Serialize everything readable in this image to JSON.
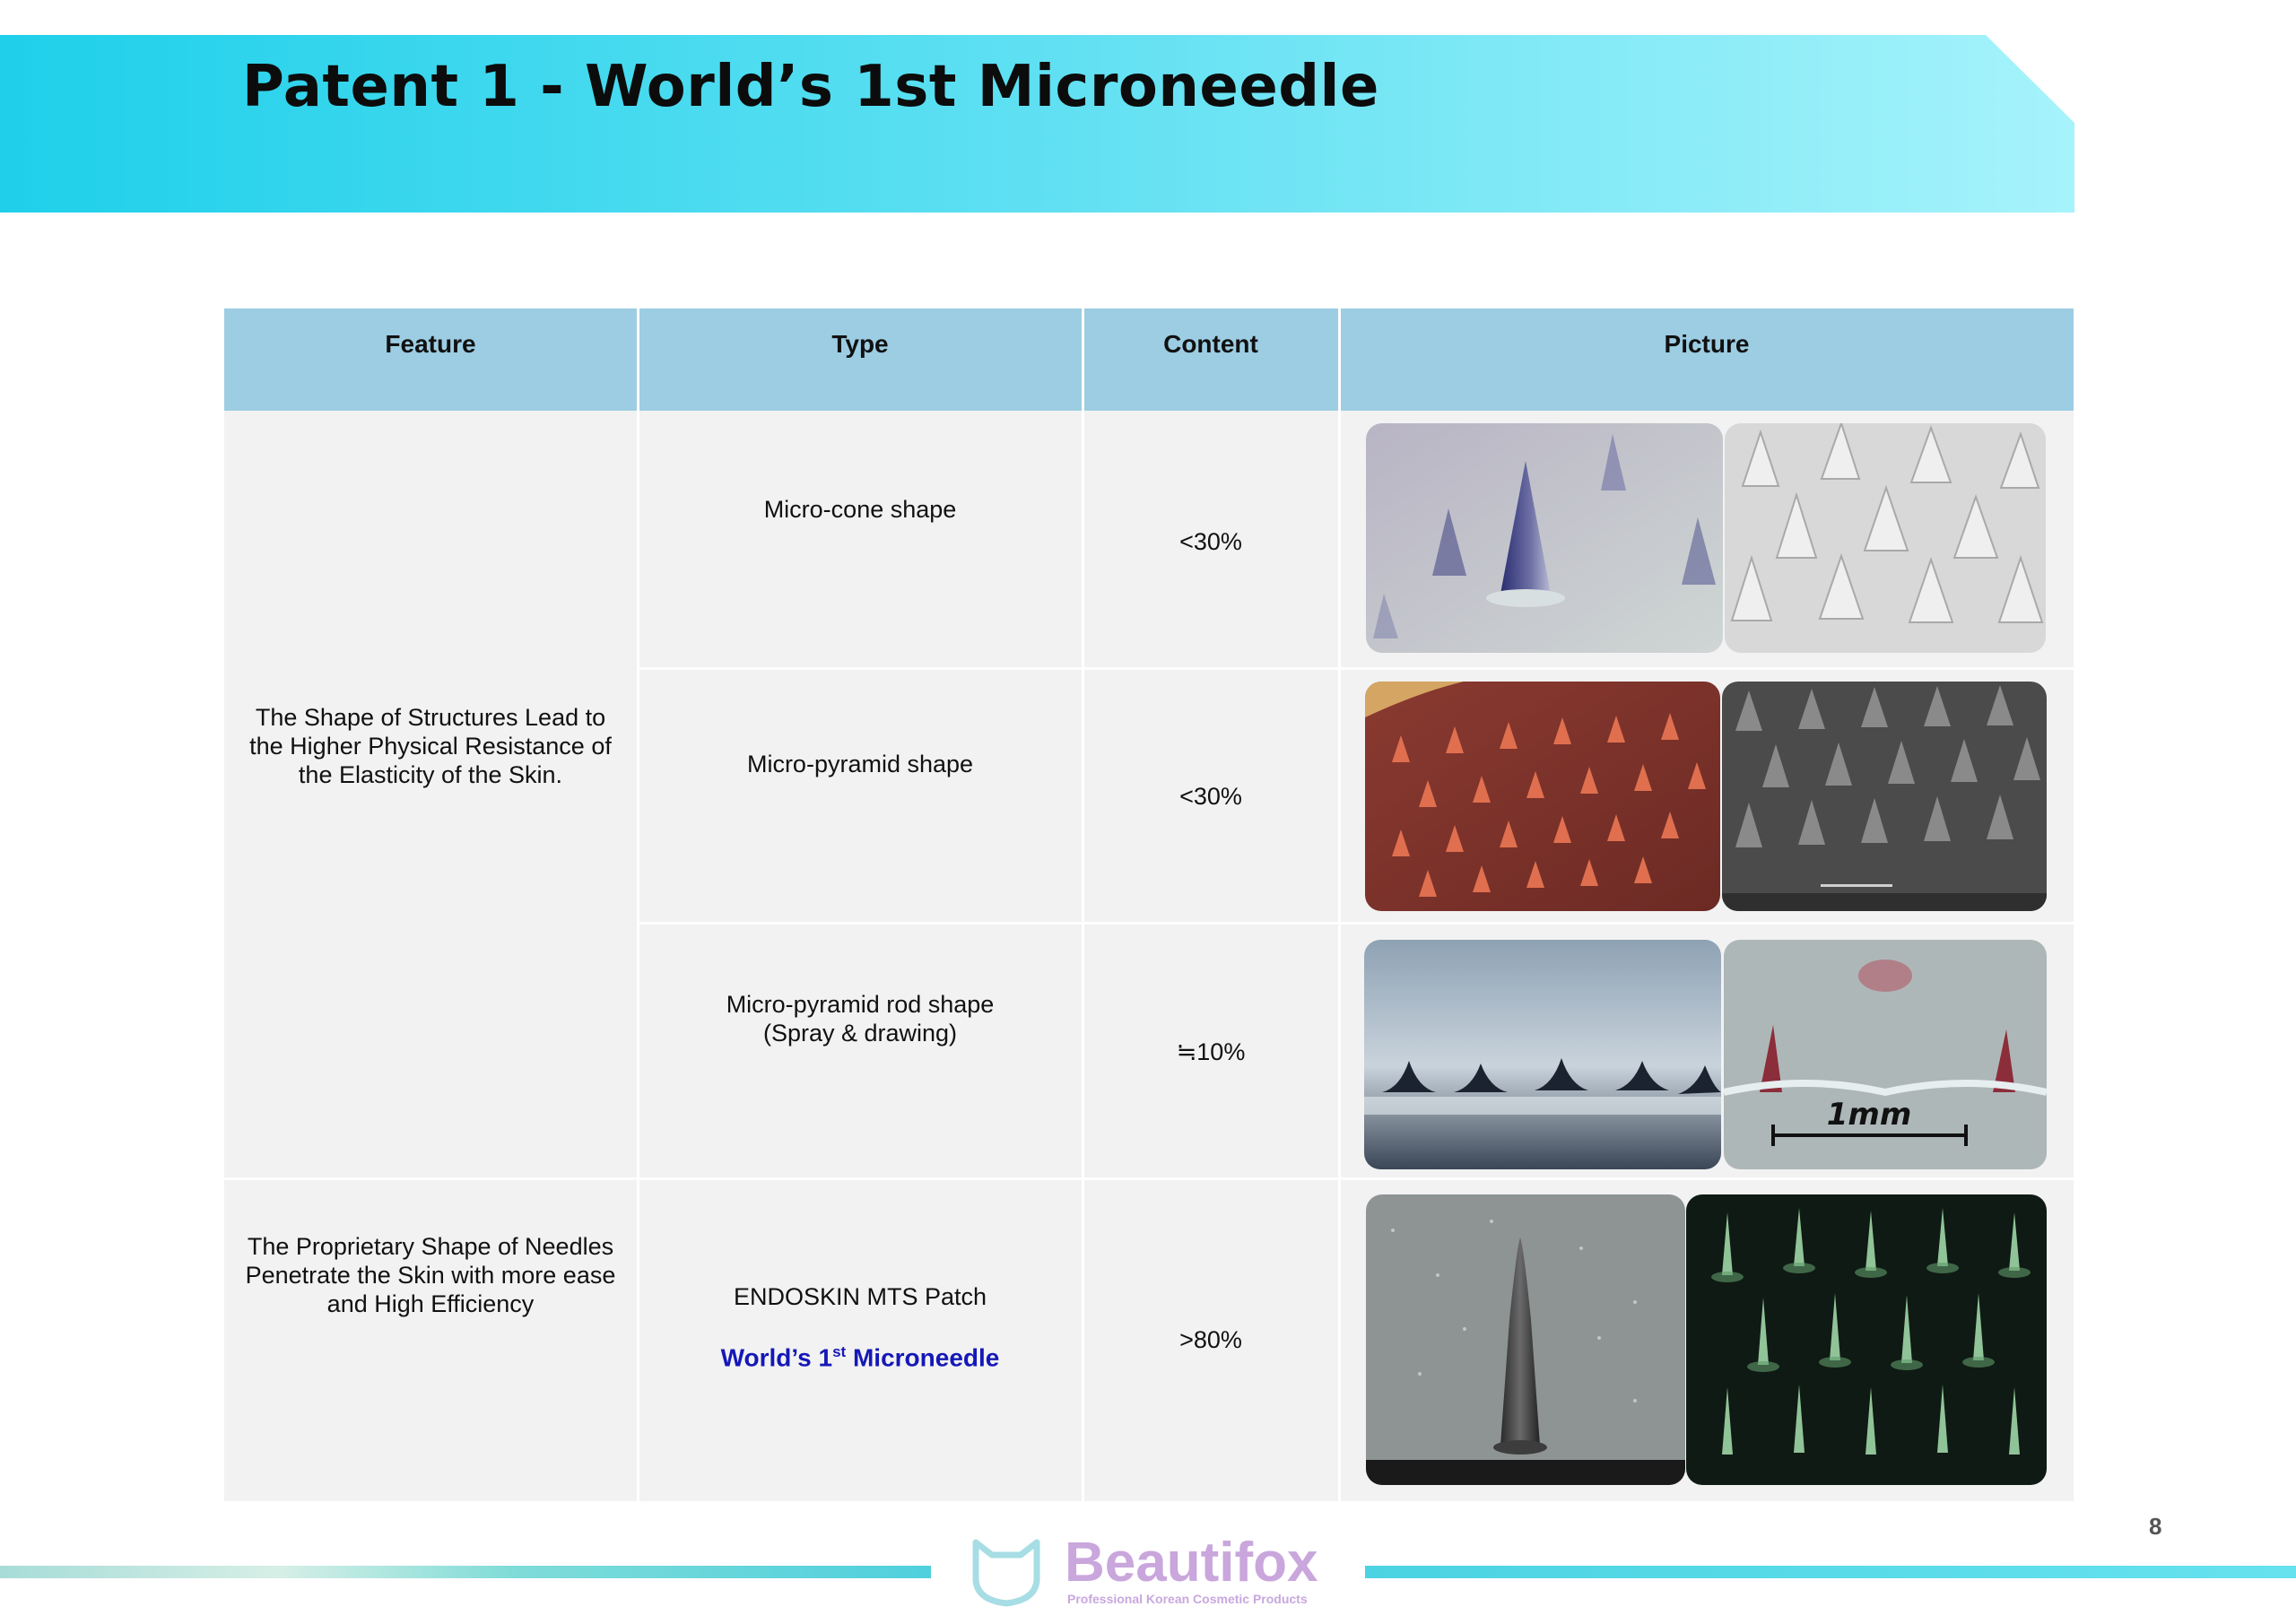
{
  "title": "Patent 1 - World’s 1st Microneedle",
  "table": {
    "headers": [
      "Feature",
      "Type",
      "Content",
      "Picture"
    ],
    "features": [
      "The Shape of Structures Lead to the Higher Physical Resistance of the Elasticity of the Skin.",
      "The Proprietary Shape of Needles Penetrate the Skin with more ease and High Efficiency"
    ],
    "rows": [
      {
        "type": "Micro-cone shape",
        "type2": "",
        "content": "<30%"
      },
      {
        "type": "Micro-pyramid shape",
        "type2": "",
        "content": "<30%"
      },
      {
        "type": "Micro-pyramid rod shape",
        "type2": "(Spray & drawing)",
        "content": "≒10%"
      },
      {
        "type": "ENDOSKIN MTS Patch",
        "type2": "",
        "content": ">80%"
      }
    ],
    "highlight": {
      "prefix": "World’s 1",
      "sup": "st",
      "suffix": " Microneedle"
    },
    "picture_labels": {
      "scale": "1mm"
    }
  },
  "footer": {
    "brand": "Beautifox",
    "tagline": "Professional Korean Cosmetic Products",
    "page": "8"
  },
  "colors": {
    "banner_start": "#1fd0ea",
    "banner_end": "#a6f3fb",
    "header_bg": "#9ccde3",
    "body_bg": "#f2f2f2",
    "highlight": "#1518b7",
    "logo": "#c9a6dc"
  }
}
